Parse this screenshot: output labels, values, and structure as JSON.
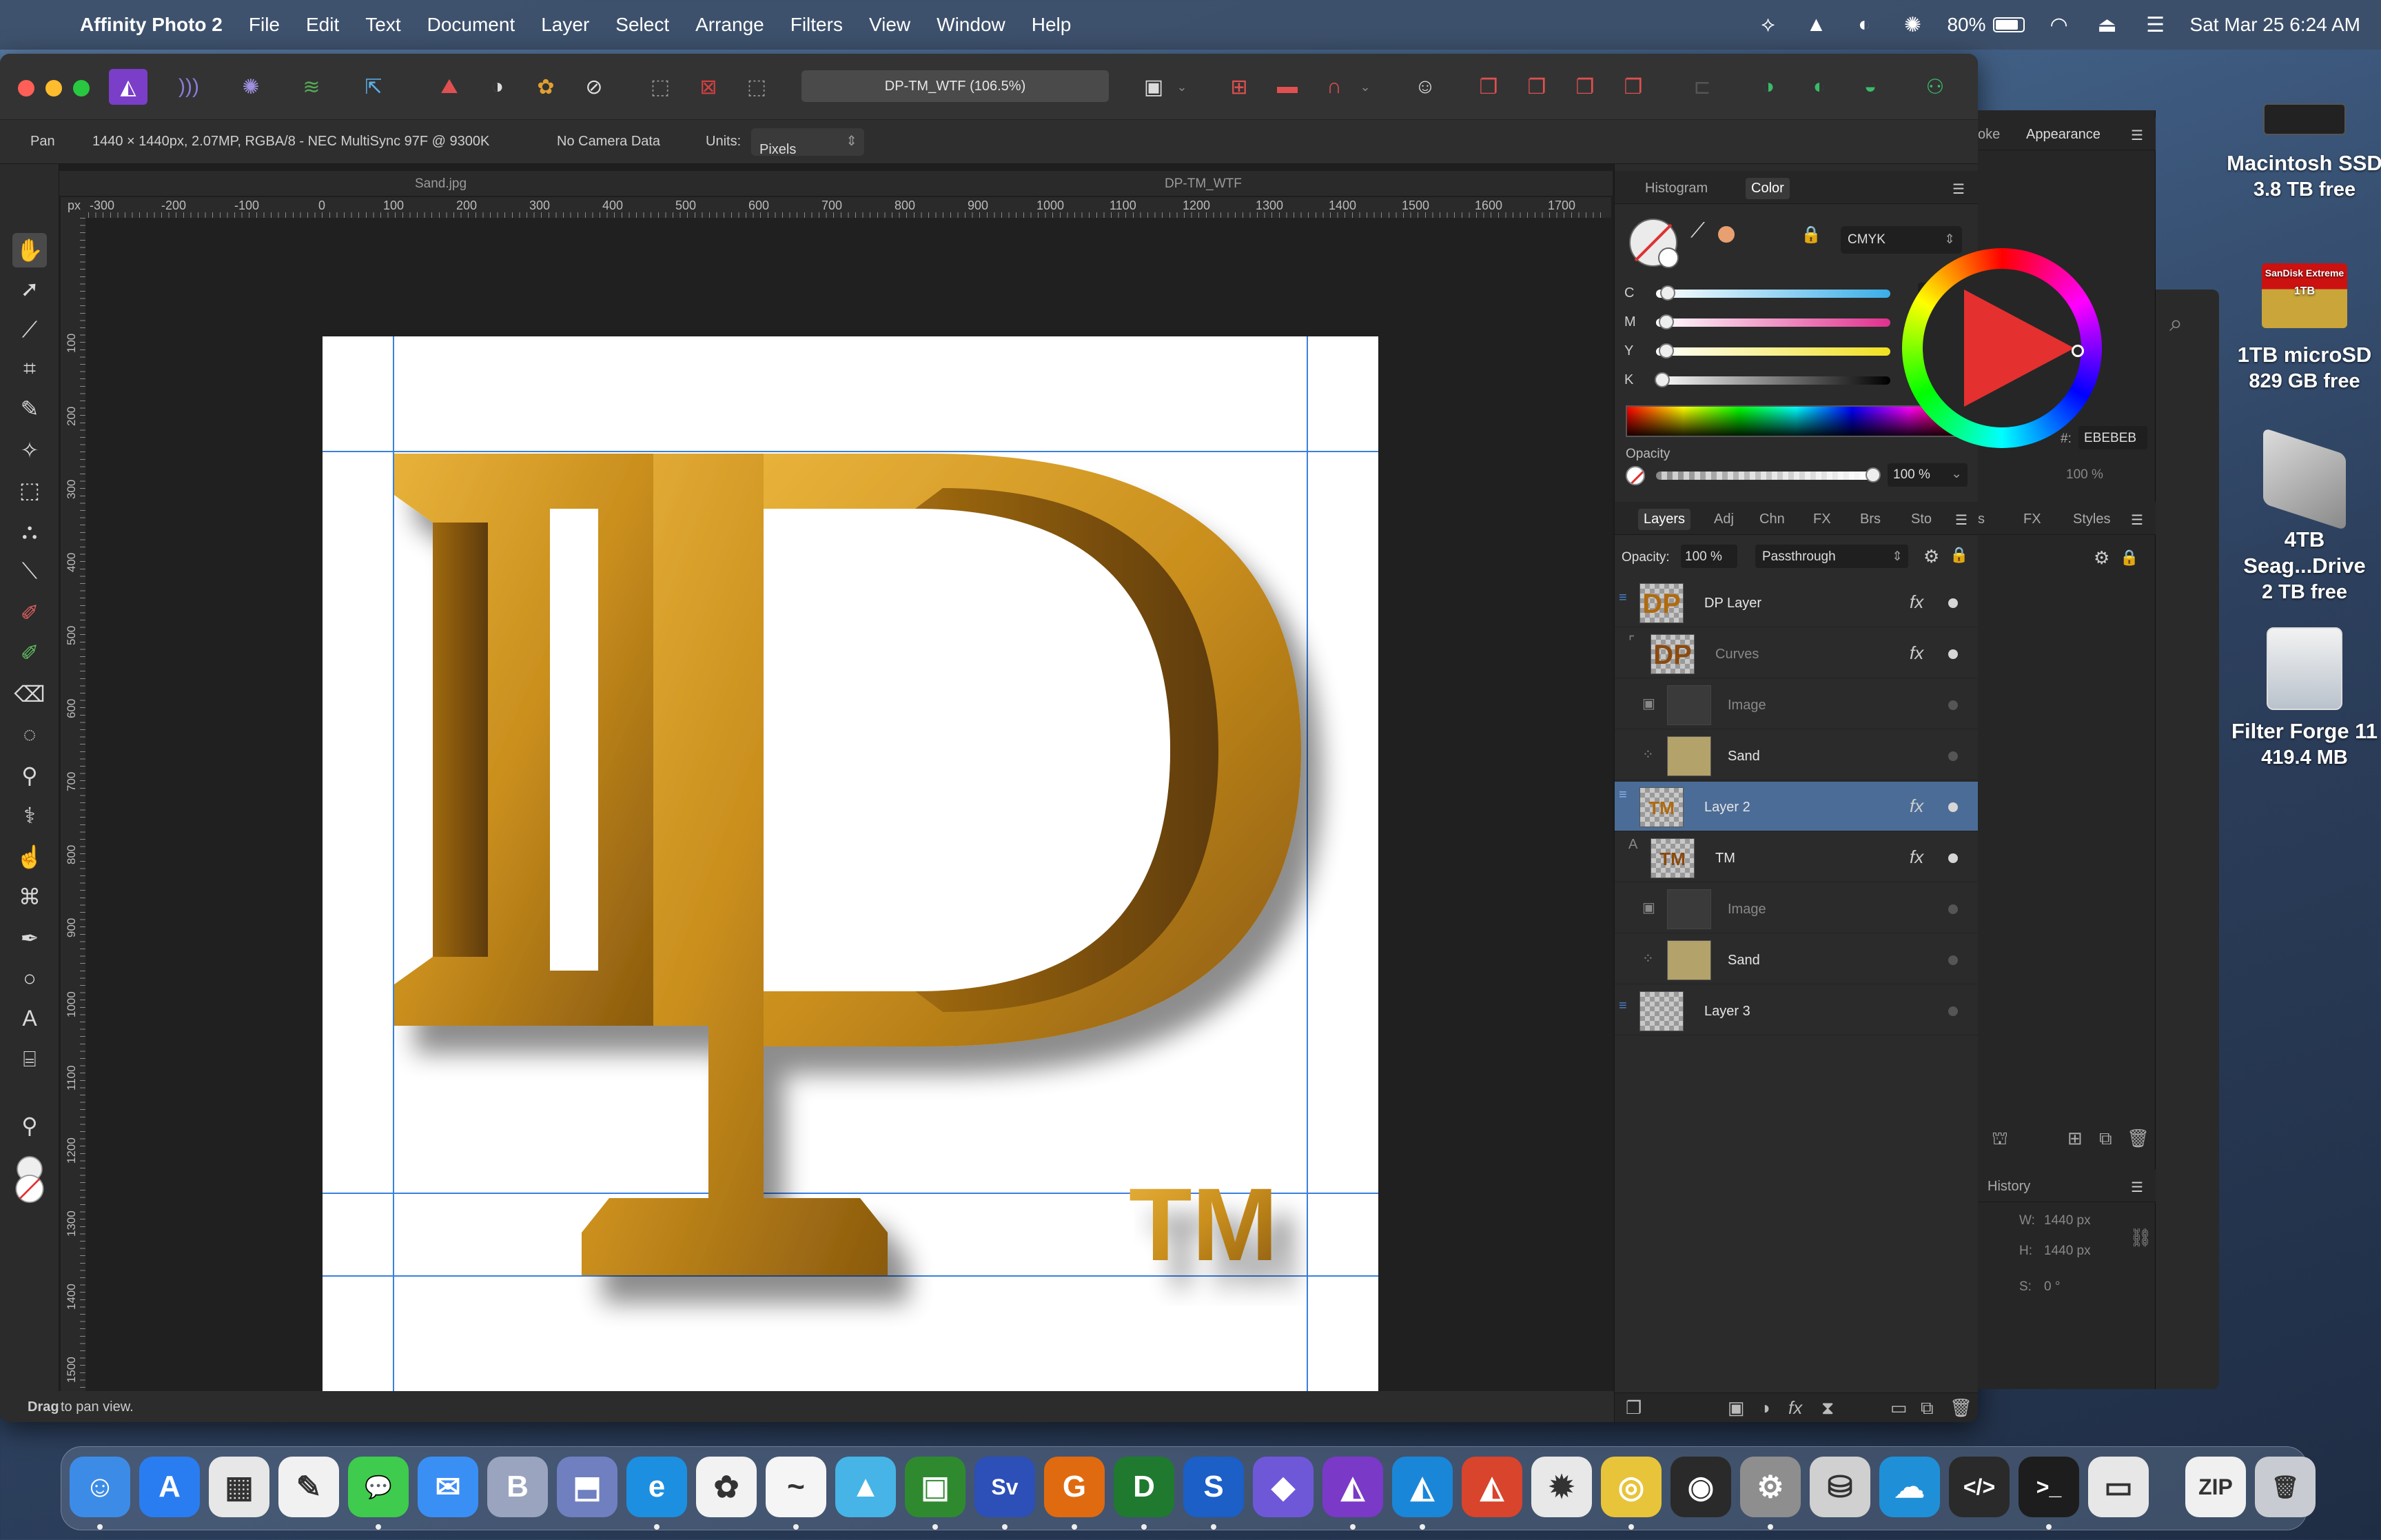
{
  "menubar": {
    "app_name": "Affinity Photo 2",
    "items": [
      "File",
      "Edit",
      "Text",
      "Document",
      "Layer",
      "Select",
      "Arrange",
      "Filters",
      "View",
      "Window",
      "Help"
    ],
    "battery": "80%",
    "datetime": "Sat Mar 25  6:24 AM"
  },
  "window": {
    "doc_title": "DP-TM_WTF (106.5%)",
    "context": {
      "tool": "Pan",
      "doc_info": "1440 × 1440px, 2.07MP, RGBA/8 - NEC MultiSync 97F @ 9300K",
      "camera": "No Camera Data",
      "units_label": "Units:",
      "units_value": "Pixels"
    },
    "doc_tabs": [
      "Sand.jpg",
      "DP-TM_WTF"
    ],
    "ruler_unit": "px",
    "ruler_top": [
      "-300",
      "-200",
      "-100",
      "0",
      "100",
      "200",
      "300",
      "400",
      "500",
      "600",
      "700",
      "800",
      "900",
      "1000",
      "1100",
      "1200",
      "1300",
      "1400",
      "1500",
      "1600",
      "1700"
    ],
    "ruler_left": [
      "100",
      "200",
      "300",
      "400",
      "500",
      "600",
      "700",
      "800",
      "900",
      "1000",
      "1100",
      "1200",
      "1300",
      "1400",
      "1500"
    ],
    "status": {
      "bold": "Drag",
      "text": " to pan view."
    }
  },
  "canvas": {
    "logo_letters": "DP",
    "tm": "TM",
    "gold": "#c8901c"
  },
  "color_panel": {
    "tabs": [
      "Histogram",
      "Color"
    ],
    "active_tab": "Color",
    "model": "CMYK",
    "channels": [
      {
        "label": "C",
        "value": "6"
      },
      {
        "label": "M",
        "value": "5"
      },
      {
        "label": "Y",
        "value": "5"
      },
      {
        "label": "K",
        "value": "0"
      }
    ],
    "opacity_label": "Opacity",
    "opacity_value": "100 %"
  },
  "layers_panel": {
    "tabs": [
      "Layers",
      "Adj",
      "Chn",
      "FX",
      "Brs",
      "Sto"
    ],
    "active_tab": "Layers",
    "opacity_label": "Opacity:",
    "opacity_value": "100 %",
    "blend_mode": "Passthrough",
    "rows": [
      {
        "name": "DP Layer",
        "thumb": "DP"
      },
      {
        "name": "Curves",
        "thumb": "DP"
      },
      {
        "name": "Image",
        "thumb": ""
      },
      {
        "name": "Sand",
        "thumb": ""
      },
      {
        "name": "Layer 2",
        "thumb": "TM"
      },
      {
        "name": "TM",
        "thumb": "TM"
      },
      {
        "name": "Image",
        "thumb": ""
      },
      {
        "name": "Sand",
        "thumb": ""
      },
      {
        "name": "Layer 3",
        "thumb": ""
      }
    ]
  },
  "side_window": {
    "tabs": [
      "oke",
      "Appearance"
    ],
    "tabs2": [
      "s",
      "FX",
      "Styles"
    ],
    "hex_label": "#:",
    "hex_value": "EBEBEB",
    "opacity": "100 %",
    "history_title": "History",
    "w_label": "W:",
    "w_value": "1440 px",
    "h_label": "H:",
    "h_value": "1440 px",
    "s_label": "S:",
    "s_value": "0 °"
  },
  "desktop": {
    "icons": [
      {
        "name": "Macintosh SSD",
        "sub": "3.8 TB free"
      },
      {
        "name": "1TB microSD",
        "sub": "829 GB free"
      },
      {
        "name": "4TB Seag...Drive",
        "sub": "2 TB free"
      },
      {
        "name": "Filter Forge 11",
        "sub": "419.4 MB"
      }
    ],
    "sandisk": "SanDisk Extreme",
    "sandisk_size": "1TB"
  },
  "dock": {
    "apps": [
      {
        "name": "Finder",
        "glyph": "☺",
        "color": "#3c8ce7"
      },
      {
        "name": "App Store",
        "glyph": "A",
        "color": "#2a7df0"
      },
      {
        "name": "Launchpad",
        "glyph": "▦",
        "color": "#e7e7e7"
      },
      {
        "name": "TextEdit",
        "glyph": "✎",
        "color": "#f1f1f1"
      },
      {
        "name": "Messages",
        "glyph": "💬",
        "color": "#3fcb4d"
      },
      {
        "name": "Mail",
        "glyph": "✉",
        "color": "#3a8ff5"
      },
      {
        "name": "BBEdit",
        "glyph": "B",
        "color": "#9aa4bf"
      },
      {
        "name": "Archive",
        "glyph": "⬒",
        "color": "#6f7fc0"
      },
      {
        "name": "Edge",
        "glyph": "e",
        "color": "#1d8fe0"
      },
      {
        "name": "Photos",
        "glyph": "✿",
        "color": "#f2f2f2"
      },
      {
        "name": "Freeform",
        "glyph": "~",
        "color": "#f5f5f5"
      },
      {
        "name": "Preview",
        "glyph": "▲",
        "color": "#46b4e6"
      },
      {
        "name": "Gif Brewery",
        "glyph": "▣",
        "color": "#2f8a2f"
      },
      {
        "name": "Sv Pro",
        "glyph": "Sv",
        "color": "#2c4fb8"
      },
      {
        "name": "G app",
        "glyph": "G",
        "color": "#e06a10"
      },
      {
        "name": "D app",
        "glyph": "D",
        "color": "#1f7a2f"
      },
      {
        "name": "S app",
        "glyph": "S",
        "color": "#1b5fc7"
      },
      {
        "name": "Gem",
        "glyph": "◆",
        "color": "#6f58d8"
      },
      {
        "name": "Affinity Photo",
        "glyph": "◭",
        "color": "#7b39c7"
      },
      {
        "name": "Affinity Designer",
        "glyph": "◭",
        "color": "#1a86d8"
      },
      {
        "name": "Affinity Publisher",
        "glyph": "◭",
        "color": "#d8442c"
      },
      {
        "name": "PhoneTools",
        "glyph": "✹",
        "color": "#e8e8e8"
      },
      {
        "name": "Chrome",
        "glyph": "◎",
        "color": "#e8c43a"
      },
      {
        "name": "OBS",
        "glyph": "◉",
        "color": "#2a2a2a"
      },
      {
        "name": "System Settings",
        "glyph": "⚙",
        "color": "#8e8e8e"
      },
      {
        "name": "Disk Utility",
        "glyph": "⛁",
        "color": "#d0d0d0"
      },
      {
        "name": "Cloud",
        "glyph": "☁",
        "color": "#1f90d8"
      },
      {
        "name": "Code",
        "glyph": "</>",
        "color": "#2a2a2a"
      },
      {
        "name": "Terminal",
        "glyph": ">_",
        "color": "#1d1d1d"
      },
      {
        "name": "Screens",
        "glyph": "▭",
        "color": "#e7e7e7"
      },
      {
        "name": "Archive Zip",
        "glyph": "ZIP",
        "color": "#f0f0f0"
      },
      {
        "name": "Trash",
        "glyph": "🗑",
        "color": "#c8ccd2"
      }
    ]
  }
}
